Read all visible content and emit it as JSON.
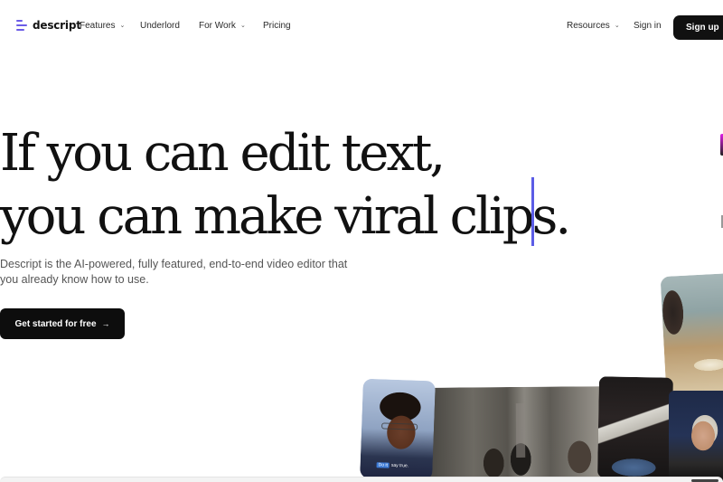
{
  "nav": {
    "brand": "descript",
    "items": [
      {
        "label": "Features",
        "has_dropdown": true
      },
      {
        "label": "Underlord",
        "has_dropdown": false
      },
      {
        "label": "For Work",
        "has_dropdown": true
      },
      {
        "label": "Pricing",
        "has_dropdown": false
      }
    ],
    "right_items": [
      {
        "label": "Resources",
        "has_dropdown": true
      },
      {
        "label": "Sign in",
        "has_dropdown": false
      }
    ],
    "signup_label": "Sign up",
    "chevron_glyph": "⌄"
  },
  "hero": {
    "headline_line1": "If you can edit text,",
    "headline_line2": "you can make viral clips.",
    "subtitle": "Descript is the AI-powered, fully featured, end-to-end video editor that you already know how to use.",
    "cta_label": "Get started for free",
    "cta_arrow": "→"
  },
  "media": {
    "face_caption_highlight": "Do it",
    "face_caption_rest": "say true."
  },
  "colors": {
    "brand_accent": "#6b5ce7",
    "cursor": "#5b5ce6",
    "button_bg": "#111111"
  }
}
